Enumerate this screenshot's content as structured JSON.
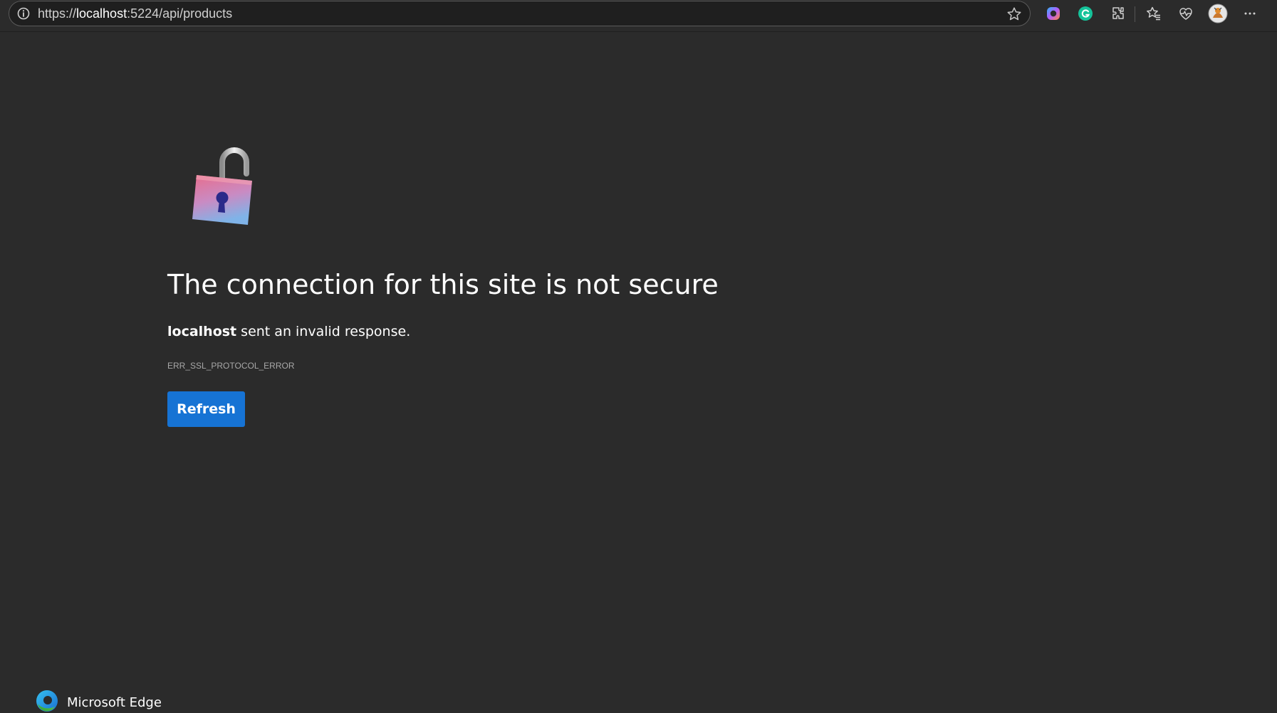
{
  "browser": {
    "url_prefix": "https://",
    "url_host": "localhost",
    "url_suffix": ":5224/api/products",
    "toolbar_icons": [
      "favorite-star-icon",
      "copilot-icon",
      "grammarly-icon",
      "extensions-icon",
      "favorites-icon",
      "browser-essentials-icon",
      "profile-avatar",
      "more-menu-icon"
    ]
  },
  "error_page": {
    "title": "The connection for this site is not secure",
    "host": "localhost",
    "message": " sent an invalid response.",
    "error_code": "ERR_SSL_PROTOCOL_ERROR",
    "refresh_label": "Refresh",
    "brand": "Microsoft Edge"
  },
  "colors": {
    "background": "#2b2b2b",
    "accent": "#1673d4",
    "text": "#ffffff",
    "muted": "#a8a8a8"
  }
}
